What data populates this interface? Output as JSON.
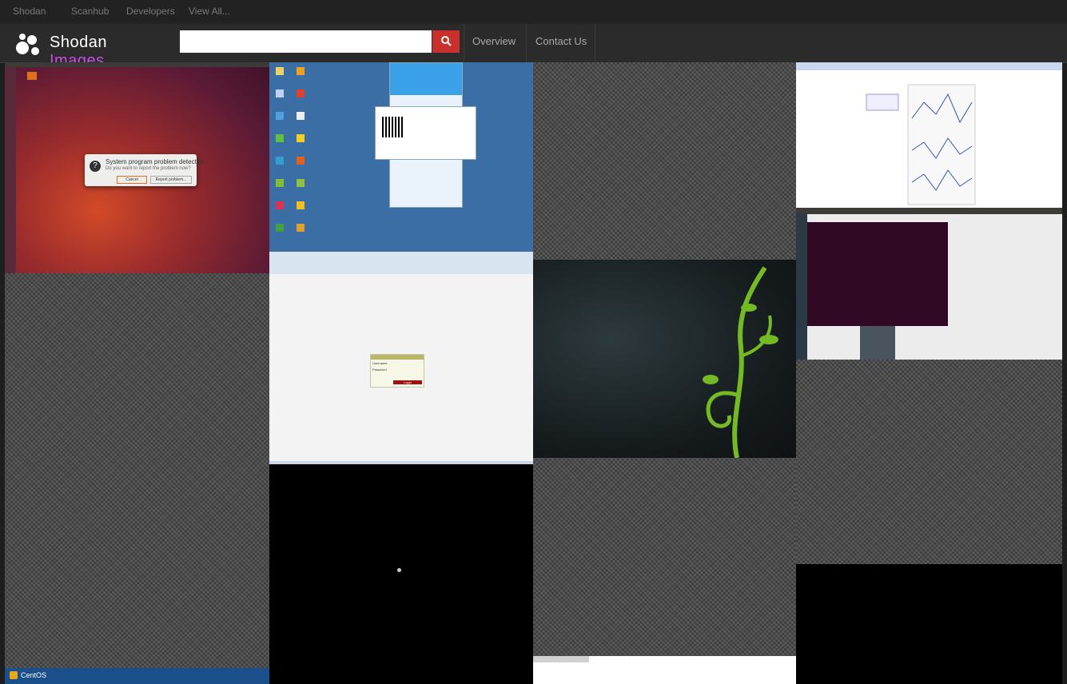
{
  "topnav": [
    "Shodan",
    "Scanhub",
    "Developers",
    "View All..."
  ],
  "brand": {
    "main": "Shodan",
    "sub": "Images"
  },
  "search": {
    "value": "",
    "placeholder": ""
  },
  "nav": {
    "overview": "Overview",
    "contact": "Contact Us"
  },
  "icons": {
    "logo": "shodan-logo-icon",
    "search": "search-icon"
  },
  "colors": {
    "brand_accent": "#c94de6",
    "search_button": "#c9302c",
    "header_bg": "#2b2b2b",
    "topbar_bg": "#222222"
  },
  "tiles": {
    "ubuntu": {
      "dialog_title": "System program problem detected",
      "dialog_text": "Do you want to report the problem now?",
      "cancel": "Cancel",
      "report": "Report problem..."
    },
    "login": {
      "username_label": "Username",
      "password_label": "Password",
      "login_button": "Login"
    },
    "centos": {
      "label": "CentOS"
    }
  }
}
